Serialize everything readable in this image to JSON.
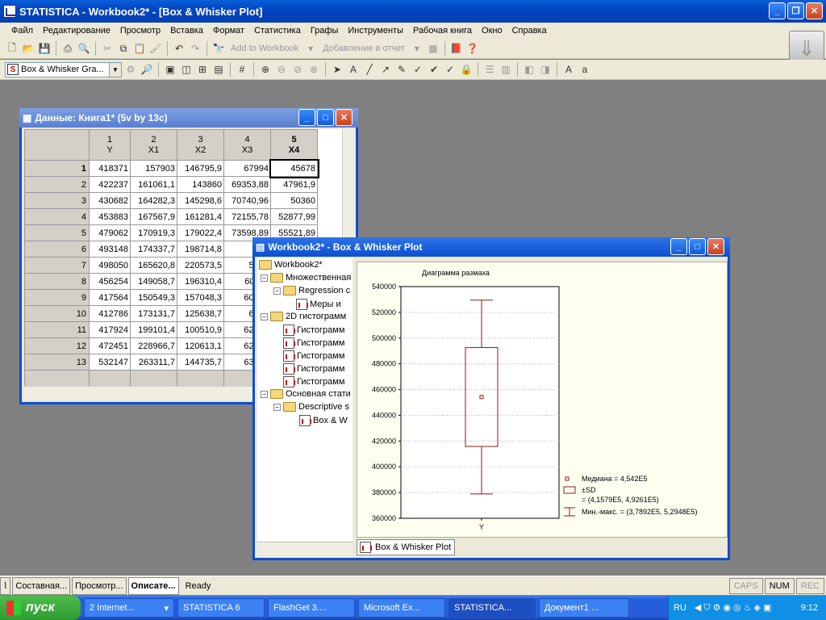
{
  "app": {
    "title": "STATISTICA - Workbook2* - [Box & Whisker Plot]"
  },
  "menu": [
    "Файл",
    "Редактирование",
    "Просмотр",
    "Вставка",
    "Формат",
    "Статистика",
    "Графы",
    "Инструменты",
    "Рабочая книга",
    "Окно",
    "Справка"
  ],
  "toolbar1": {
    "add_to_workbook": "Add to Workbook",
    "add_to_report": "Добавление в отчет"
  },
  "toolbar2": {
    "graph_combo": "Box & Whisker Gra..."
  },
  "data_window": {
    "title": "Данные: Книга1* (5v by 13c)",
    "columns": [
      {
        "num": "1",
        "name": "Y"
      },
      {
        "num": "2",
        "name": "X1"
      },
      {
        "num": "3",
        "name": "X2"
      },
      {
        "num": "4",
        "name": "X3"
      },
      {
        "num": "5",
        "name": "X4"
      }
    ],
    "rows": [
      [
        "1",
        "418371",
        "157903",
        "146795,9",
        "67994",
        "45678"
      ],
      [
        "2",
        "422237",
        "161061,1",
        "143860",
        "69353,88",
        "47961,9"
      ],
      [
        "3",
        "430682",
        "164282,3",
        "145298,6",
        "70740,96",
        "50360"
      ],
      [
        "4",
        "453883",
        "167567,9",
        "161281,4",
        "72155,78",
        "52877,99"
      ],
      [
        "5",
        "479062",
        "170919,3",
        "179022,4",
        "73598,89",
        "55521,89"
      ],
      [
        "6",
        "493148",
        "174337,7",
        "198714,8",
        "662",
        ""
      ],
      [
        "7",
        "498050",
        "165620,8",
        "220573,5",
        "5961",
        ""
      ],
      [
        "8",
        "456254",
        "149058,7",
        "196310,4",
        "60211",
        ""
      ],
      [
        "9",
        "417564",
        "150549,3",
        "157048,3",
        "60813",
        ""
      ],
      [
        "10",
        "412786",
        "173131,7",
        "125638,7",
        "6142",
        ""
      ],
      [
        "11",
        "417924",
        "199101,4",
        "100510,9",
        "62035",
        ""
      ],
      [
        "12",
        "472451",
        "228966,7",
        "120613,1",
        "62656",
        ""
      ],
      [
        "13",
        "532147",
        "263311,7",
        "144735,7",
        "63282",
        ""
      ]
    ]
  },
  "workbook_window": {
    "title": "Workbook2* - Box & Whisker Plot",
    "tree": {
      "root": "Workbook2*",
      "n1": "Множественная",
      "n1a": "Regression с",
      "n1a1": "Меры и",
      "n2": "2D гистограмм",
      "hist": "Гистограмм",
      "n3": "Основная стати",
      "n3a": "Descriptive s",
      "n3a1": "Box & W"
    },
    "tab_label": "Box & Whisker Plot"
  },
  "chart_data": {
    "type": "box",
    "title": "Диаграмма размаха",
    "categories": [
      "Y"
    ],
    "median": 454200,
    "box_low": 415790,
    "box_high": 492610,
    "whisker_low": 378920,
    "whisker_high": 529480,
    "ylim": [
      360000,
      540000
    ],
    "yticks": [
      "540000",
      "520000",
      "500000",
      "480000",
      "460000",
      "440000",
      "420000",
      "400000",
      "380000",
      "360000"
    ],
    "legend": {
      "median": "Медиана = 4,542E5",
      "sd": "±SD",
      "sd_range": "= (4,1579E5, 4,9261E5)",
      "minmax": "Мин.-макс. = (3,7892E5, 5,2948E5)"
    },
    "color": "#8b1a1a",
    "grid": true
  },
  "statusbar": {
    "tabs": [
      "Составная...",
      "Просмотр...",
      "Описате..."
    ],
    "ready": "Ready",
    "caps": "CAPS",
    "num": "NUM",
    "rec": "REC"
  },
  "taskbar": {
    "start": "пуск",
    "buttons": [
      "2 Internet...",
      "STATISTICA 6",
      "FlashGet 3....",
      "Microsoft Ex...",
      "STATISTICA...",
      "Документ1 ..."
    ],
    "lang": "RU",
    "clock": "9:12"
  }
}
